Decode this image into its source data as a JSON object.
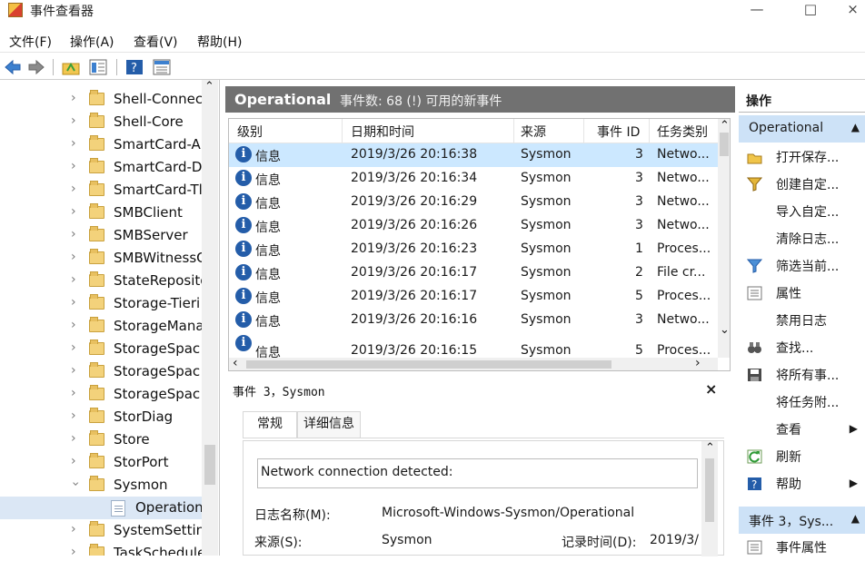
{
  "window": {
    "title": "事件查看器",
    "min": "—",
    "max": "□",
    "close": "×"
  },
  "menu": [
    "文件(F)",
    "操作(A)",
    "查看(V)",
    "帮助(H)"
  ],
  "toolbar": {
    "icons": [
      "back-arrow-icon",
      "forward-arrow-icon",
      "up-folder-icon",
      "show-hide-tree-icon",
      "help-icon",
      "properties-pane-icon"
    ]
  },
  "tree": {
    "items": [
      {
        "label": "Shell-Connec",
        "type": "folder"
      },
      {
        "label": "Shell-Core",
        "type": "folder"
      },
      {
        "label": "SmartCard-A",
        "type": "folder"
      },
      {
        "label": "SmartCard-D",
        "type": "folder"
      },
      {
        "label": "SmartCard-Tl",
        "type": "folder"
      },
      {
        "label": "SMBClient",
        "type": "folder"
      },
      {
        "label": "SMBServer",
        "type": "folder"
      },
      {
        "label": "SMBWitnessC",
        "type": "folder"
      },
      {
        "label": "StateReposito",
        "type": "folder"
      },
      {
        "label": "Storage-Tieri",
        "type": "folder"
      },
      {
        "label": "StorageMana",
        "type": "folder"
      },
      {
        "label": "StorageSpac",
        "type": "folder"
      },
      {
        "label": "StorageSpac",
        "type": "folder"
      },
      {
        "label": "StorageSpac",
        "type": "folder"
      },
      {
        "label": "StorDiag",
        "type": "folder"
      },
      {
        "label": "Store",
        "type": "folder"
      },
      {
        "label": "StorPort",
        "type": "folder"
      },
      {
        "label": "Sysmon",
        "type": "folder",
        "expanded": true
      },
      {
        "label": "Operation",
        "type": "log",
        "selected": true
      },
      {
        "label": "SystemSetting",
        "type": "folder"
      },
      {
        "label": "TaskSchedule",
        "type": "folder"
      }
    ]
  },
  "log": {
    "name": "Operational",
    "count_text": "事件数: 68 (!) 可用的新事件"
  },
  "grid": {
    "columns": [
      "级别",
      "日期和时间",
      "来源",
      "事件 ID",
      "任务类别"
    ],
    "rows": [
      {
        "level": "信息",
        "datetime": "2019/3/26 20:16:38",
        "source": "Sysmon",
        "id": "3",
        "task": "Netwo...",
        "selected": true
      },
      {
        "level": "信息",
        "datetime": "2019/3/26 20:16:34",
        "source": "Sysmon",
        "id": "3",
        "task": "Netwo..."
      },
      {
        "level": "信息",
        "datetime": "2019/3/26 20:16:29",
        "source": "Sysmon",
        "id": "3",
        "task": "Netwo..."
      },
      {
        "level": "信息",
        "datetime": "2019/3/26 20:16:26",
        "source": "Sysmon",
        "id": "3",
        "task": "Netwo..."
      },
      {
        "level": "信息",
        "datetime": "2019/3/26 20:16:23",
        "source": "Sysmon",
        "id": "1",
        "task": "Proces..."
      },
      {
        "level": "信息",
        "datetime": "2019/3/26 20:16:17",
        "source": "Sysmon",
        "id": "2",
        "task": "File cr..."
      },
      {
        "level": "信息",
        "datetime": "2019/3/26 20:16:17",
        "source": "Sysmon",
        "id": "5",
        "task": "Proces..."
      },
      {
        "level": "信息",
        "datetime": "2019/3/26 20:16:16",
        "source": "Sysmon",
        "id": "3",
        "task": "Netwo..."
      },
      {
        "level": "信息",
        "datetime": "2019/3/26 20:16:15",
        "source": "Sysmon",
        "id": "5",
        "task": "Proces..."
      }
    ]
  },
  "detail": {
    "title": "事件 3，Sysmon",
    "close": "×",
    "tabs": [
      "常规",
      "详细信息"
    ],
    "message": "Network connection detected:",
    "log_name_label": "日志名称(M):",
    "log_name_value": "Microsoft-Windows-Sysmon/Operational",
    "source_label": "来源(S):",
    "source_value": "Sysmon",
    "logged_label": "记录时间(D):",
    "logged_value": "2019/3/"
  },
  "actions": {
    "title": "操作",
    "section1": "Operational",
    "items": [
      {
        "label": "打开保存...",
        "icon": "open-folder-icon"
      },
      {
        "label": "创建自定...",
        "icon": "filter-icon"
      },
      {
        "label": "导入自定...",
        "icon": ""
      },
      {
        "label": "清除日志...",
        "icon": ""
      },
      {
        "label": "筛选当前...",
        "icon": "filter-icon"
      },
      {
        "label": "属性",
        "icon": "properties-icon"
      },
      {
        "label": "禁用日志",
        "icon": ""
      },
      {
        "label": "查找...",
        "icon": "binoculars-icon"
      },
      {
        "label": "将所有事...",
        "icon": "save-icon"
      },
      {
        "label": "将任务附...",
        "icon": ""
      },
      {
        "label": "查看",
        "icon": "",
        "submenu": "▶"
      },
      {
        "label": "刷新",
        "icon": "refresh-icon"
      },
      {
        "label": "帮助",
        "icon": "help-icon",
        "submenu": "▶"
      }
    ],
    "section2": "事件 3，Sys...",
    "section2_item": "事件属性"
  },
  "colors": {
    "selected_row": "#cce8ff",
    "log_header": "#717171",
    "accent": "#245da9"
  }
}
